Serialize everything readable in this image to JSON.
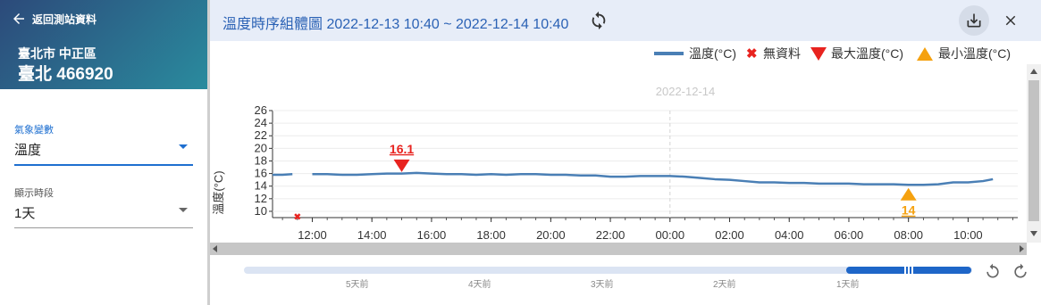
{
  "sidebar": {
    "back_label": "返回測站資料",
    "station_area": "臺北市 中正區",
    "station_name": "臺北 466920",
    "variable": {
      "label": "氣象變數",
      "value": "溫度"
    },
    "period": {
      "label": "顯示時段",
      "value": "1天"
    }
  },
  "header": {
    "title": "溫度時序組體圖 2022-12-13 10:40 ~ 2022-12-14 10:40"
  },
  "legend": {
    "line": "溫度(°C)",
    "missing": "無資料",
    "max": "最大溫度(°C)",
    "min": "最小溫度(°C)"
  },
  "colors": {
    "line": "#4a7fb5",
    "max": "#e8231f",
    "min": "#f5a10f",
    "accent": "#2b62b5"
  },
  "chart_data": {
    "type": "line",
    "ylabel": "溫度(°C)",
    "ylim": [
      9,
      26
    ],
    "yticks": [
      10,
      12,
      14,
      16,
      18,
      20,
      22,
      24,
      26
    ],
    "x_start": "2022-12-13 10:40",
    "x_end": "2022-12-14 11:40",
    "xtick_labels": [
      "12:00",
      "14:00",
      "16:00",
      "18:00",
      "20:00",
      "22:00",
      "00:00",
      "02:00",
      "04:00",
      "06:00",
      "08:00",
      "10:00"
    ],
    "date_marker": "2022-12-14",
    "series": [
      {
        "name": "溫度(°C)",
        "x": [
          "2022-12-13 10:40",
          "2022-12-13 11:00",
          "2022-12-13 11:20",
          "2022-12-13 11:40",
          "2022-12-13 12:00",
          "2022-12-13 12:30",
          "2022-12-13 13:00",
          "2022-12-13 13:30",
          "2022-12-13 14:00",
          "2022-12-13 14:30",
          "2022-12-13 15:00",
          "2022-12-13 15:30",
          "2022-12-13 16:00",
          "2022-12-13 16:30",
          "2022-12-13 17:00",
          "2022-12-13 17:30",
          "2022-12-13 18:00",
          "2022-12-13 18:30",
          "2022-12-13 19:00",
          "2022-12-13 19:30",
          "2022-12-13 20:00",
          "2022-12-13 20:30",
          "2022-12-13 21:00",
          "2022-12-13 21:30",
          "2022-12-13 22:00",
          "2022-12-13 22:30",
          "2022-12-13 23:00",
          "2022-12-13 23:30",
          "2022-12-14 00:00",
          "2022-12-14 00:30",
          "2022-12-14 01:00",
          "2022-12-14 01:30",
          "2022-12-14 02:00",
          "2022-12-14 02:30",
          "2022-12-14 03:00",
          "2022-12-14 03:30",
          "2022-12-14 04:00",
          "2022-12-14 04:30",
          "2022-12-14 05:00",
          "2022-12-14 05:30",
          "2022-12-14 06:00",
          "2022-12-14 06:30",
          "2022-12-14 07:00",
          "2022-12-14 07:30",
          "2022-12-14 08:00",
          "2022-12-14 08:30",
          "2022-12-14 09:00",
          "2022-12-14 09:30",
          "2022-12-14 10:00",
          "2022-12-14 10:30",
          "2022-12-14 10:50"
        ],
        "values": [
          15.8,
          15.8,
          15.9,
          null,
          15.9,
          15.9,
          15.8,
          15.8,
          15.9,
          16.0,
          16.0,
          16.1,
          16.0,
          15.9,
          15.9,
          15.8,
          15.9,
          15.8,
          15.9,
          15.9,
          15.8,
          15.8,
          15.7,
          15.7,
          15.5,
          15.5,
          15.6,
          15.6,
          15.6,
          15.5,
          15.3,
          15.1,
          15.0,
          14.8,
          14.6,
          14.6,
          14.5,
          14.5,
          14.4,
          14.4,
          14.4,
          14.3,
          14.3,
          14.3,
          14.2,
          14.2,
          14.3,
          14.6,
          14.6,
          14.8,
          15.1
        ]
      }
    ],
    "missing": [
      {
        "x": "2022-12-13 11:30",
        "y": 9.2
      }
    ],
    "max_point": {
      "x": "2022-12-13 15:00",
      "y": 16.1,
      "label": "16.1"
    },
    "min_point": {
      "x": "2022-12-14 08:00",
      "y": 14,
      "label": "14"
    }
  },
  "range": {
    "labels": [
      "5天前",
      "4天前",
      "3天前",
      "2天前",
      "1天前"
    ]
  }
}
